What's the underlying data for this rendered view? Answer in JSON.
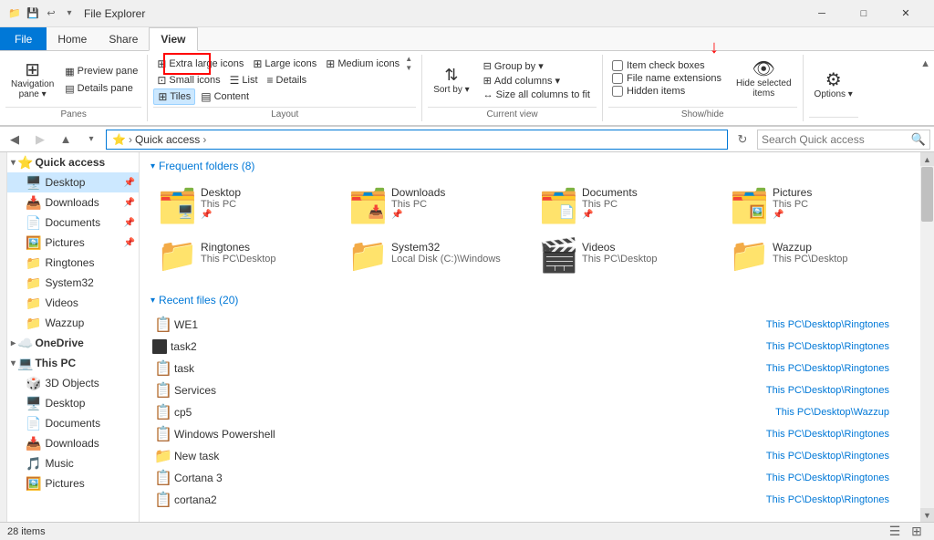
{
  "titlebar": {
    "title": "File Explorer",
    "icons": [
      "📁",
      "💾",
      "↩️"
    ],
    "controls": [
      "─",
      "□",
      "✕"
    ]
  },
  "ribbon": {
    "tabs": [
      "File",
      "Home",
      "Share",
      "View"
    ],
    "active_tab": "View",
    "groups": {
      "panes": {
        "label": "Panes",
        "items": [
          {
            "label": "Navigation\npane",
            "icon": "⊞"
          },
          {
            "label": "Preview pane",
            "icon": "▦"
          },
          {
            "label": "Details pane",
            "icon": "▤"
          }
        ]
      },
      "layout": {
        "label": "Layout",
        "items": [
          "Extra large icons",
          "Large icons",
          "Medium icons",
          "Small icons",
          "List",
          "Details",
          "Tiles",
          "Content"
        ],
        "active": "Tiles"
      },
      "current_view": {
        "label": "Current view",
        "items": [
          "Sort by ▾",
          "Add columns ▾",
          "Size all columns to fit",
          "Group by ▾"
        ]
      },
      "show_hide": {
        "label": "Show/hide",
        "checkboxes": [
          {
            "label": "Item check boxes",
            "checked": false
          },
          {
            "label": "File name extensions",
            "checked": false
          },
          {
            "label": "Hidden items",
            "checked": false
          }
        ],
        "buttons": [
          "Hide selected\nitems"
        ]
      },
      "options": {
        "label": "",
        "btn": "Options"
      }
    }
  },
  "address_bar": {
    "back_disabled": false,
    "forward_disabled": true,
    "up_disabled": false,
    "path": "Quick access",
    "search_placeholder": "Search Quick access"
  },
  "sidebar": {
    "sections": [
      {
        "type": "group",
        "label": "Quick access",
        "icon": "⭐",
        "expanded": true,
        "selected": true,
        "items": [
          {
            "label": "Desktop",
            "icon": "🖥️",
            "pinned": true
          },
          {
            "label": "Downloads",
            "icon": "📥",
            "pinned": true
          },
          {
            "label": "Documents",
            "icon": "📄",
            "pinned": true
          },
          {
            "label": "Pictures",
            "icon": "🖼️",
            "pinned": true
          },
          {
            "label": "Ringtones",
            "icon": "📁"
          },
          {
            "label": "System32",
            "icon": "📁"
          },
          {
            "label": "Videos",
            "icon": "📁"
          },
          {
            "label": "Wazzup",
            "icon": "📁"
          }
        ]
      },
      {
        "type": "group",
        "label": "OneDrive",
        "icon": "☁️",
        "expanded": false,
        "items": []
      },
      {
        "type": "group",
        "label": "This PC",
        "icon": "💻",
        "expanded": true,
        "items": [
          {
            "label": "3D Objects",
            "icon": "🎲"
          },
          {
            "label": "Desktop",
            "icon": "🖥️"
          },
          {
            "label": "Documents",
            "icon": "📄"
          },
          {
            "label": "Downloads",
            "icon": "📥"
          },
          {
            "label": "Music",
            "icon": "🎵"
          },
          {
            "label": "Pictures",
            "icon": "🖼️"
          }
        ]
      }
    ]
  },
  "content": {
    "frequent_folders": {
      "title": "Frequent folders",
      "count": 8,
      "folders": [
        {
          "name": "Desktop",
          "path": "This PC",
          "icon": "🖥️",
          "has_overlay": true
        },
        {
          "name": "Downloads",
          "path": "This PC",
          "icon": "📥",
          "has_overlay": true
        },
        {
          "name": "Documents",
          "path": "This PC",
          "icon": "📄",
          "has_overlay": true
        },
        {
          "name": "Pictures",
          "path": "This PC",
          "icon": "🖼️",
          "has_overlay": true
        },
        {
          "name": "Ringtones",
          "path": "This PC\\Desktop",
          "icon": "📁"
        },
        {
          "name": "System32",
          "path": "Local Disk (C:)\\Windows",
          "icon": "📁"
        },
        {
          "name": "Videos",
          "path": "This PC\\Desktop",
          "icon": "🎬"
        },
        {
          "name": "Wazzup",
          "path": "This PC\\Desktop",
          "icon": "📁"
        }
      ]
    },
    "recent_files": {
      "title": "Recent files",
      "count": 20,
      "files": [
        {
          "name": "WE1",
          "path": "This PC\\Desktop\\Ringtones",
          "icon": "📋"
        },
        {
          "name": "task2",
          "path": "This PC\\Desktop\\Ringtones",
          "icon": "⬛"
        },
        {
          "name": "task",
          "path": "This PC\\Desktop\\Ringtones",
          "icon": "📋"
        },
        {
          "name": "Services",
          "path": "This PC\\Desktop\\Ringtones",
          "icon": "📋"
        },
        {
          "name": "cp5",
          "path": "This PC\\Desktop\\Wazzup",
          "icon": "📋"
        },
        {
          "name": "Windows Powershell",
          "path": "This PC\\Desktop\\Ringtones",
          "icon": "📋"
        },
        {
          "name": "New task",
          "path": "This PC\\Desktop\\Ringtones",
          "icon": "📁"
        },
        {
          "name": "Cortana 3",
          "path": "This PC\\Desktop\\Ringtones",
          "icon": "📋"
        },
        {
          "name": "cortana2",
          "path": "This PC\\Desktop\\Ringtones",
          "icon": "📋"
        }
      ]
    }
  },
  "statusbar": {
    "item_count": "28 items",
    "view_icons": [
      "☰",
      "⊞"
    ]
  },
  "annotations": {
    "red_box_around": "View tab",
    "red_arrow_points_to": "Item check boxes"
  }
}
